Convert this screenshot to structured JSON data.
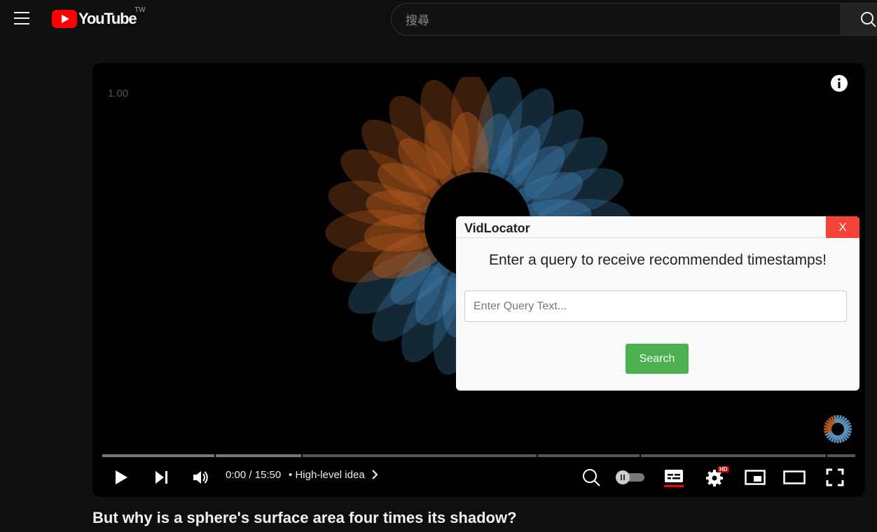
{
  "header": {
    "logo_text": "YouTube",
    "country_code": "TW",
    "search_placeholder": "搜尋"
  },
  "player": {
    "speed_label": "1.00",
    "time": "0:00 / 15:50",
    "chapter_separator": "•",
    "chapter": "High-level idea",
    "progress_fraction": 0.0,
    "hd_badge": "HD",
    "autoplay_on": false
  },
  "video": {
    "title": "But why is a sphere's surface area four times its shadow?"
  },
  "popup": {
    "title": "VidLocator",
    "close_label": "X",
    "prompt": "Enter a query to receive recommended timestamps!",
    "input_placeholder": "Enter Query Text...",
    "input_value": "",
    "search_label": "Search"
  },
  "colors": {
    "youtube_red": "#ff0000",
    "close_red": "#f44336",
    "search_green": "#4caf50",
    "flower_blue": "#3b78a6",
    "flower_orange": "#b35a1f"
  },
  "icons": {
    "menu": "hamburger-menu-icon",
    "search": "search-icon",
    "info": "info-icon",
    "play": "play-icon",
    "next": "skip-next-icon",
    "volume": "volume-icon",
    "chapter": "chevron-right-icon",
    "zoom_search": "search-icon",
    "autoplay": "autoplay-toggle-icon",
    "subtitles": "subtitles-icon",
    "settings": "gear-icon",
    "miniplayer": "miniplayer-icon",
    "theater": "theater-mode-icon",
    "fullscreen": "fullscreen-icon"
  }
}
